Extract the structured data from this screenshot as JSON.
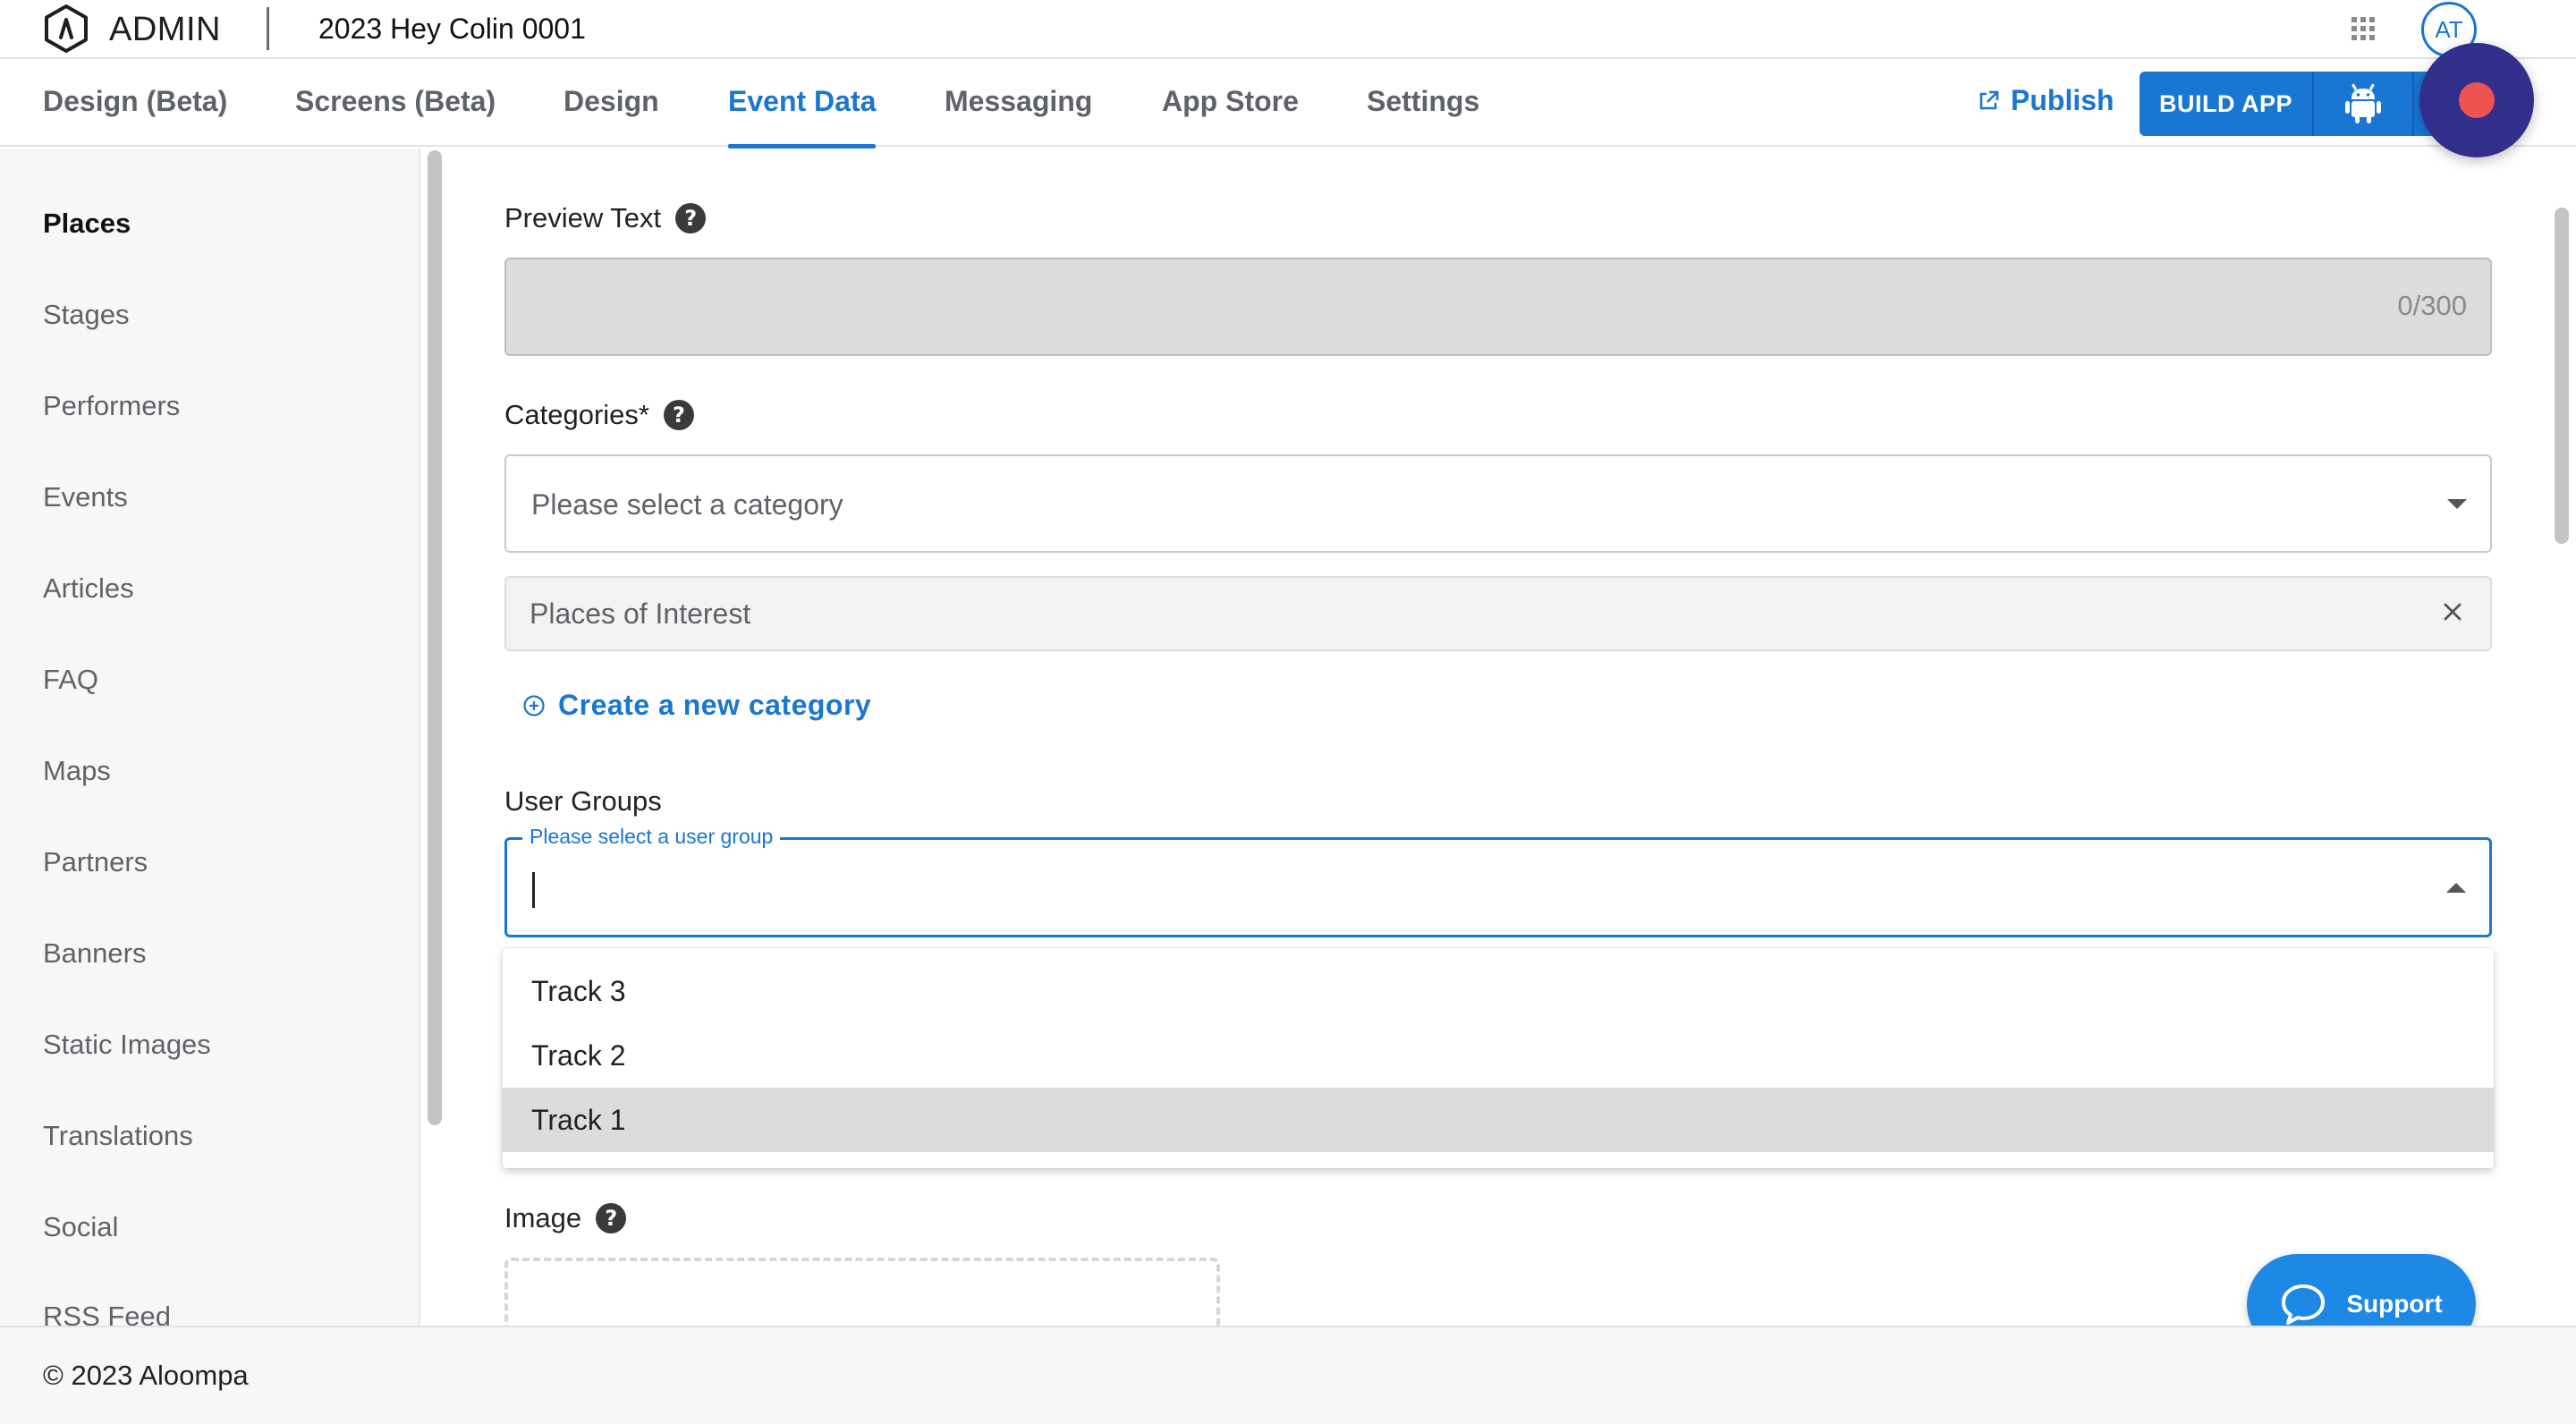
{
  "header": {
    "admin_label": "ADMIN",
    "event_title": "2023 Hey Colin 0001",
    "avatar_initials": "AT"
  },
  "nav": {
    "tabs": [
      {
        "label": "Design (Beta)",
        "active": false
      },
      {
        "label": "Screens (Beta)",
        "active": false
      },
      {
        "label": "Design",
        "active": false
      },
      {
        "label": "Event Data",
        "active": true
      },
      {
        "label": "Messaging",
        "active": false
      },
      {
        "label": "App Store",
        "active": false
      },
      {
        "label": "Settings",
        "active": false
      }
    ],
    "publish_label": "Publish",
    "build_app_label": "BUILD APP"
  },
  "sidebar": {
    "items": [
      {
        "label": "Places",
        "active": true
      },
      {
        "label": "Stages"
      },
      {
        "label": "Performers"
      },
      {
        "label": "Events"
      },
      {
        "label": "Articles"
      },
      {
        "label": "FAQ"
      },
      {
        "label": "Maps"
      },
      {
        "label": "Partners"
      },
      {
        "label": "Banners"
      },
      {
        "label": "Static Images"
      },
      {
        "label": "Translations"
      },
      {
        "label": "Social"
      },
      {
        "label": "RSS Feed"
      }
    ]
  },
  "form": {
    "preview_text": {
      "label": "Preview Text",
      "value": "",
      "counter": "0/300"
    },
    "categories": {
      "label": "Categories*",
      "placeholder": "Please select a category",
      "selected_chips": [
        "Places of Interest"
      ],
      "create_link": "Create a new category"
    },
    "user_groups": {
      "label": "User Groups",
      "floating_label": "Please select a user group",
      "value": "",
      "options": [
        "Track 3",
        "Track 2",
        "Track 1"
      ],
      "highlighted_option": "Track 1"
    },
    "image": {
      "label": "Image"
    }
  },
  "support_label": "Support",
  "footer": {
    "copyright": "© 2023 Aloompa"
  },
  "colors": {
    "accent": "#1976d2",
    "record_button": "#312e8c",
    "record_dot": "#ef5350"
  }
}
